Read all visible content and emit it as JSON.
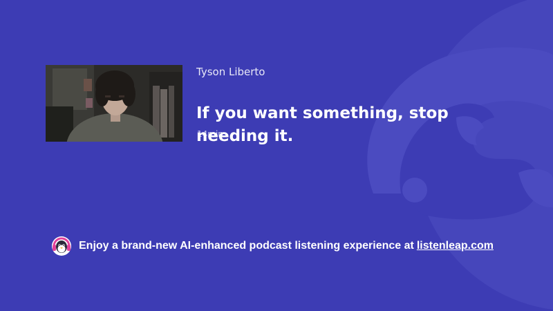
{
  "episode": {
    "author": "Tyson Liberto",
    "title": "If you want something, stop needing it.",
    "duration": "14min",
    "thumbnail_icon": "person-photo"
  },
  "footer": {
    "promo_text": "Enjoy a brand-new AI-enhanced podcast listening experience at",
    "link_text": "listenleap.com",
    "logo_icon": "penguin-headphones-icon"
  },
  "colors": {
    "background": "#3d3cb4",
    "watermark": "#4a4abf",
    "text": "#ffffff"
  }
}
